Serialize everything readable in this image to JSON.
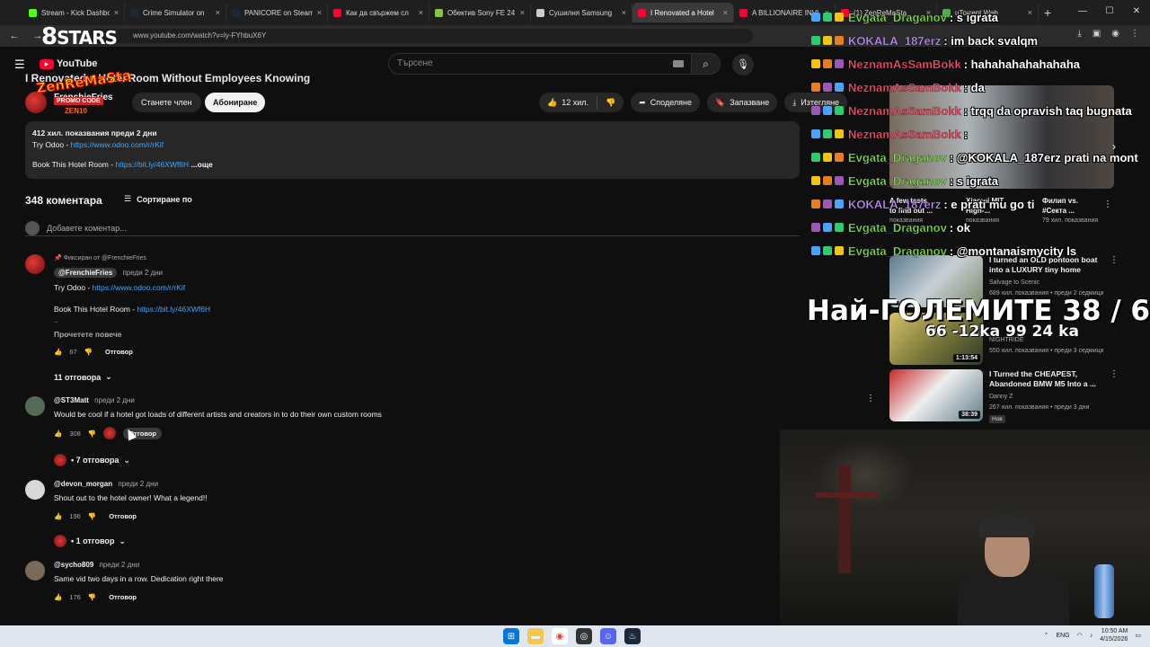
{
  "browser": {
    "tabs": [
      {
        "label": "Stream - Kick Dashbo",
        "color": "#53fc18"
      },
      {
        "label": "Crime Simulator on",
        "color": "#1b2838"
      },
      {
        "label": "PANICORE on Steam",
        "color": "#1b2838"
      },
      {
        "label": "Как да свържем сл",
        "color": "#ff0033"
      },
      {
        "label": "Обектив Sony FE 24",
        "color": "#8bc34a"
      },
      {
        "label": "Сушилня Samsung",
        "color": "#cccccc"
      },
      {
        "label": "I Renovated a Hotel",
        "color": "#ff0033",
        "active": true
      },
      {
        "label": "A BILLIONAIRE INVI",
        "color": "#ff0033"
      },
      {
        "label": "(1) ZenReMaSta",
        "color": "#ff0033"
      },
      {
        "label": "uTorrent Web",
        "color": "#4caf50"
      }
    ],
    "url": "www.youtube.com/watch?v=ly-FYhbuX6Y",
    "new_tab": "+"
  },
  "overlay": {
    "stars": "STARS",
    "brand": "ZenReMaSta",
    "promo_label": "PROMO CODE",
    "promo_code": "ZEN10"
  },
  "youtube": {
    "logo_text": "YouTube",
    "search_placeholder": "Търсене"
  },
  "video": {
    "title": "I Renovated a Hotel Room Without Employees Knowing",
    "channel": "FrenchieFries",
    "join_label": "Станете член",
    "subscribe_label": "Абониране",
    "likes": "12 хил.",
    "share_label": "Споделяне",
    "save_label": "Запазване",
    "download_label": "Изтегляне",
    "views_line": "412 хил. показвания  преди 2 дни",
    "desc_line1_text": "Try Odoo - ",
    "desc_line1_link": "https://www.odoo.com/r/rKif",
    "desc_line2_text": "Book This Hotel Room - ",
    "desc_line2_link": "https://bit.ly/46XWf6H",
    "desc_more": "...още"
  },
  "comments": {
    "count_label": "348 коментара",
    "sort_label": "Сортиране по",
    "add_placeholder": "Добавете коментар...",
    "reply_label": "Отговор",
    "pinned_label": "Фиксиран от @FrenchieFries",
    "read_more": "Прочетете повече",
    "items": [
      {
        "author": "@FrenchieFries",
        "time": "преди 2 дни",
        "line1_text": "Try Odoo - ",
        "line1_link": "https://www.odoo.com/r/rKif",
        "line2_text": "Book This Hotel Room - ",
        "line2_link": "https://bit.ly/46XWf6H",
        "ellipsis": "..",
        "likes": "67",
        "replies": "11 отговора"
      },
      {
        "author": "@ST3Matt",
        "time": "преди 2 дни",
        "text": "Would be cool if a hotel got loads of different artists and creators in to do their own custom rooms",
        "likes": "308",
        "replies": "• 7 отговора"
      },
      {
        "author": "@devon_morgan",
        "time": "преди 2 дни",
        "text": "Shout out to the hotel owner!  What a legend!!",
        "likes": "196",
        "replies": "• 1 отговор"
      },
      {
        "author": "@sycho809",
        "time": "преди 2 дни",
        "text": "Same vid two days in a row. Dedication right there",
        "likes": "176"
      }
    ]
  },
  "recommendations": [
    {
      "title_1": "A few tests",
      "title_2": "to find out ...",
      "meta": "показвания",
      "col": 0
    },
    {
      "title_1": "Xiaomi MIT",
      "title_2": "High-...",
      "meta": "показвания",
      "col": 1
    },
    {
      "title_1": "Филип vs.",
      "title_2": "#Секта ...",
      "meta": "79 хил. показвания",
      "col": 2
    },
    {
      "title": "I turned an OLD pontoon boat into a LUXURY tiny home",
      "channel": "Salvage to Scenic",
      "meta": "689 хил. показвания • преди 2 седмици",
      "duration": ""
    },
    {
      "title": "DRIVING HONDA ... into a Chardeasol",
      "channel": "NIGHTRIDE",
      "meta": "550 хил. показвания • преди 3 седмици",
      "duration": "1:13:54"
    },
    {
      "title": "I Turned the CHEAPEST, Abandoned BMW M5 Into a ...",
      "channel": "Danny Z",
      "meta": "267 хил. показвания • преди 3 дни",
      "duration": "38:39",
      "badge": "Нов"
    }
  ],
  "chat": [
    {
      "user": "Evgata_Draganov",
      "msg": ": s igrata",
      "color": "#7ee04a"
    },
    {
      "user": "KOKALA_187erz",
      "msg": ": im back svalqm",
      "color": "#c38cff"
    },
    {
      "user": "NeznamAsSamBokk",
      "msg": ": hahahahahahahaha",
      "color": "#ff4d6a"
    },
    {
      "user": "NeznamAsSamBokk",
      "msg": ": da",
      "color": "#ff4d6a"
    },
    {
      "user": "NeznamAsSamBokk",
      "msg": ": trqq da opravish taq bugnata",
      "color": "#ff4d6a"
    },
    {
      "user": "NeznamAsSamBokk",
      "msg": ":",
      "color": "#ff4d6a"
    },
    {
      "user": "Evgata_Draganov",
      "msg": ": @KOKALA_187erz prati na mont",
      "color": "#7ee04a"
    },
    {
      "user": "Evgata_Draganov",
      "msg": ": s igrata",
      "color": "#7ee04a"
    },
    {
      "user": "KOKALA_187erz",
      "msg": ": e prati mu go ti",
      "color": "#c38cff"
    },
    {
      "user": "Evgata_Draganov",
      "msg": ": ok",
      "color": "#7ee04a"
    },
    {
      "user": "Evgata_Draganov",
      "msg": ": @montanaismycity ls",
      "color": "#7ee04a"
    }
  ],
  "counter": {
    "main": "Най-ГОЛЕМИТЕ 38 / 66",
    "sub": "66 -12ka 99 24 ka"
  },
  "taskbar": {
    "lang": "ENG",
    "time": "10:50 AM",
    "date": "4/15/2026"
  }
}
